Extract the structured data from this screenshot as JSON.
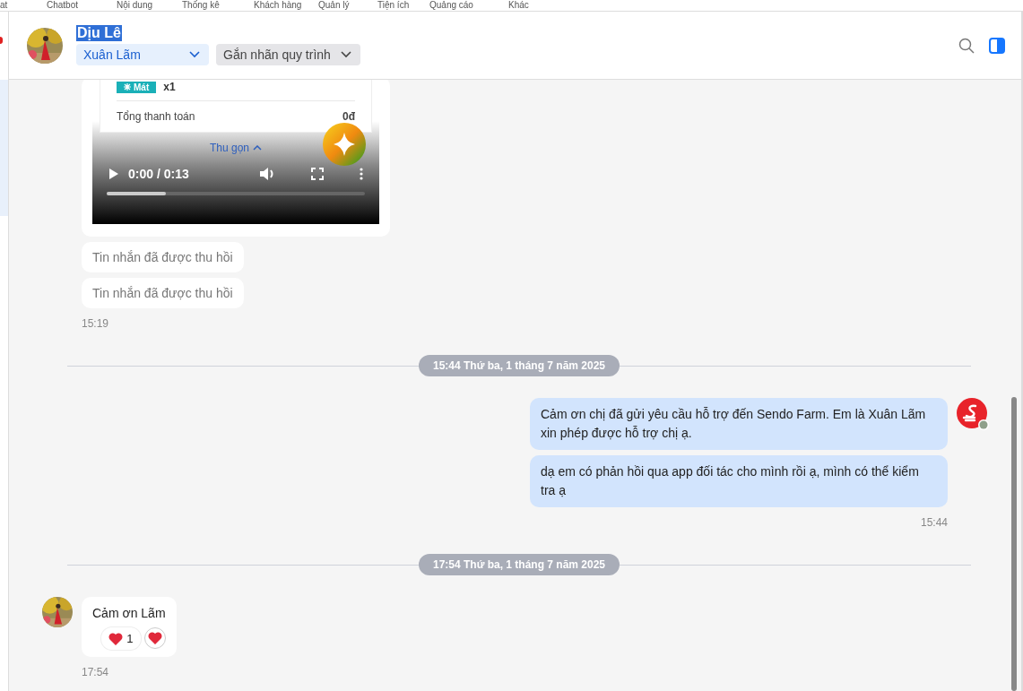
{
  "top_nav": [
    "at",
    "Chatbot",
    "Nội dung",
    "Thống kê",
    "Khách hàng",
    "Quản lý",
    "Tiện ích",
    "Quảng cáo",
    "Khác"
  ],
  "header": {
    "name": "Dịu Lê",
    "name_selected": true,
    "assignee": "Xuân Lãm",
    "label_select": "Gắn nhãn quy trình"
  },
  "chat": [
    {
      "kind": "incoming",
      "avatar": false,
      "time": "15:19",
      "items": [
        {
          "kind": "video",
          "badge": "Mát",
          "quantity": "x1",
          "total_label": "Tổng thanh toán",
          "total_value": "0đ",
          "collapse": "Thu gọn",
          "time": "0:00 / 0:13",
          "level": 0.23
        },
        {
          "kind": "recalled",
          "text": "Tin nhắn đã được thu hồi"
        },
        {
          "kind": "recalled",
          "text": "Tin nhắn đã được thu hồi"
        }
      ]
    },
    {
      "kind": "divider",
      "text": "15:44 Thứ ba, 1 tháng 7 năm 2025"
    },
    {
      "kind": "outgoing",
      "avatar": true,
      "time": "15:44",
      "items": [
        {
          "kind": "text",
          "text": "Cảm ơn chị đã gửi yêu cầu hỗ trợ đến Sendo Farm. Em là Xuân Lãm xin phép được hỗ trợ chị ạ."
        },
        {
          "kind": "text",
          "text": "dạ em có phản hồi qua app đối tác cho mình rồi ạ, mình có thể kiểm tra ạ"
        }
      ]
    },
    {
      "kind": "divider",
      "text": "17:54 Thứ ba, 1 tháng 7 năm 2025"
    },
    {
      "kind": "incoming",
      "avatar": true,
      "time": "17:54",
      "items": [
        {
          "kind": "text",
          "text": "Cảm ơn Lãm",
          "reaction_count": "1"
        }
      ]
    }
  ]
}
